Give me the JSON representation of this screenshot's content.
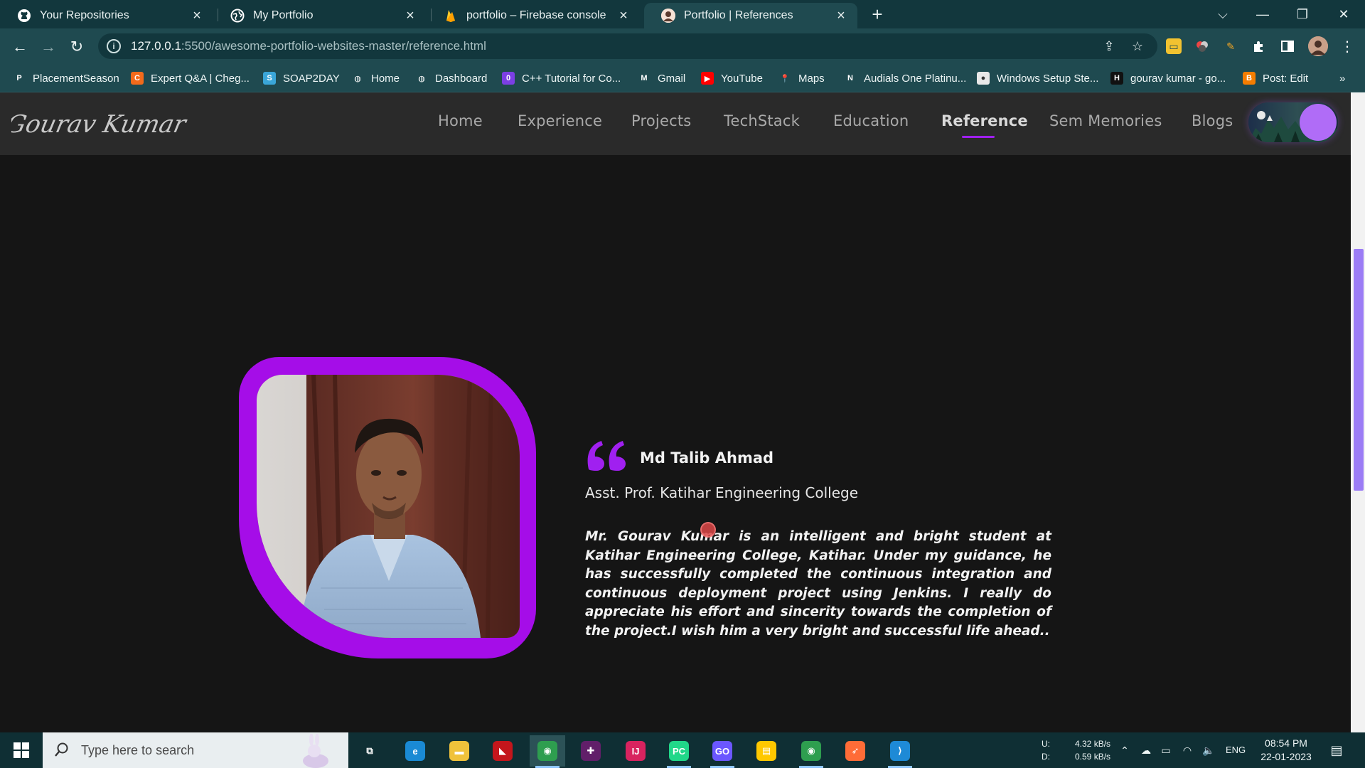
{
  "browser": {
    "tabs": [
      {
        "title": "Your Repositories",
        "icon": "github-icon"
      },
      {
        "title": "My Portfolio",
        "icon": "globe-icon"
      },
      {
        "title": "portfolio – Firebase console",
        "icon": "firebase-icon"
      },
      {
        "title": "Portfolio | References",
        "icon": "avatar-icon",
        "active": true
      }
    ],
    "url_host": "127.0.0.1",
    "url_path": ":5500/awesome-portfolio-websites-master/reference.html",
    "bookmarks": [
      {
        "label": "PlacementSeason",
        "icon": "placementseason-icon",
        "color": "#1f4a50",
        "glyph": "P"
      },
      {
        "label": "Expert Q&A | Cheg...",
        "icon": "chegg-icon",
        "color": "#f26a1b",
        "glyph": "C"
      },
      {
        "label": "SOAP2DAY",
        "icon": "soap2day-icon",
        "color": "#3aa6d8",
        "glyph": "S"
      },
      {
        "label": "Home",
        "icon": "globe-icon",
        "color": "#1f4a50",
        "glyph": "◍"
      },
      {
        "label": "Dashboard",
        "icon": "globe-icon",
        "color": "#1f4a50",
        "glyph": "◍"
      },
      {
        "label": "C++ Tutorial for Co...",
        "icon": "cpp-tutorial-icon",
        "color": "#7b3fe4",
        "glyph": "0"
      },
      {
        "label": "Gmail",
        "icon": "gmail-icon",
        "color": "#1f4a50",
        "glyph": "M"
      },
      {
        "label": "YouTube",
        "icon": "youtube-icon",
        "color": "#ff0000",
        "glyph": "▶"
      },
      {
        "label": "Maps",
        "icon": "maps-icon",
        "color": "#1f4a50",
        "glyph": "📍"
      },
      {
        "label": "Audials One Platinu...",
        "icon": "audials-icon",
        "color": "#1f4a50",
        "glyph": "N"
      },
      {
        "label": "Windows Setup Ste...",
        "icon": "windows-setup-icon",
        "color": "#e8e8e8",
        "glyph": "●"
      },
      {
        "label": "gourav kumar - go...",
        "icon": "hashnode-icon",
        "color": "#111111",
        "glyph": "H"
      },
      {
        "label": "Post: Edit",
        "icon": "blogger-icon",
        "color": "#f57d00",
        "glyph": "B"
      }
    ],
    "bookmarks_overflow": "»"
  },
  "site": {
    "logo_text": "Gourav Kumar",
    "nav": [
      "Home",
      "Experience",
      "Projects",
      "TechStack",
      "Education",
      "Reference",
      "Sem Memories",
      "Blogs"
    ],
    "active_nav": "Reference",
    "accent_color": "#a50de8"
  },
  "reference": {
    "name": "Md Talib Ahmad",
    "role": "Asst. Prof. Katihar Engineering College",
    "testimonial": "Mr. Gourav Kumar is an intelligent and bright student at Katihar Engineering College, Katihar. Under my guidance, he has successfully completed the continuous integration and continuous deployment project using Jenkins. I really do appreciate his effort and sincerity towards the completion of the project.I wish him a very bright and successful life ahead.."
  },
  "taskbar": {
    "search_placeholder": "Type here to search",
    "apps": [
      {
        "name": "task-view-icon",
        "glyph": "⧉",
        "color": "#0f2f34"
      },
      {
        "name": "edge-icon",
        "glyph": "e",
        "color": "#1a8ad4"
      },
      {
        "name": "file-explorer-icon",
        "glyph": "▬",
        "color": "#f0c23b"
      },
      {
        "name": "red-app-icon",
        "glyph": "◣",
        "color": "#c4161c"
      },
      {
        "name": "chrome-icon",
        "glyph": "◉",
        "color": "#2e9e4f"
      },
      {
        "name": "slack-icon",
        "glyph": "✚",
        "color": "#611f69"
      },
      {
        "name": "intellij-icon",
        "glyph": "IJ",
        "color": "#d8235f"
      },
      {
        "name": "pycharm-icon",
        "glyph": "PC",
        "color": "#21d789"
      },
      {
        "name": "goland-icon",
        "glyph": "GO",
        "color": "#6b57ff"
      },
      {
        "name": "sticky-notes-icon",
        "glyph": "▤",
        "color": "#ffc800"
      },
      {
        "name": "chrome-icon",
        "glyph": "◉",
        "color": "#2e9e4f"
      },
      {
        "name": "postman-icon",
        "glyph": "➶",
        "color": "#ff6c37"
      },
      {
        "name": "vscode-icon",
        "glyph": "⟩",
        "color": "#1e8ad6"
      }
    ],
    "network_up_label": "U:",
    "network_down_label": "D:",
    "network_up": "4.32 kB/s",
    "network_down": "0.59 kB/s",
    "language": "ENG",
    "time": "08:54 PM",
    "date": "22-01-2023"
  }
}
